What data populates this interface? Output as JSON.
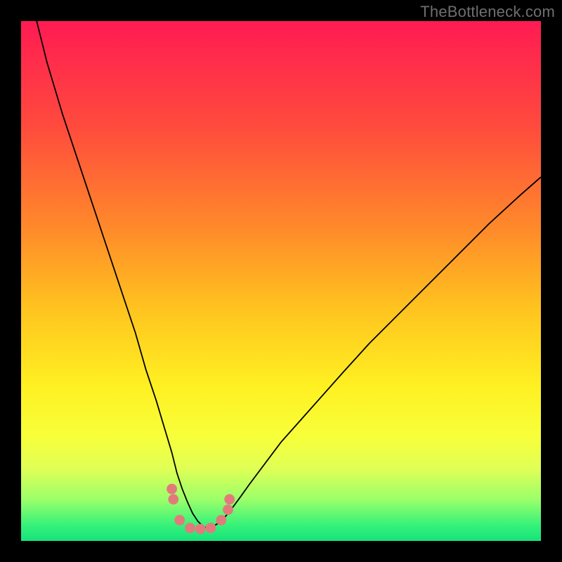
{
  "attribution": "TheBottleneck.com",
  "colors": {
    "frame": "#000000",
    "gradient_stops": [
      {
        "offset": 0.0,
        "color": "#ff1b53"
      },
      {
        "offset": 0.2,
        "color": "#ff4a3d"
      },
      {
        "offset": 0.4,
        "color": "#ff8a2a"
      },
      {
        "offset": 0.55,
        "color": "#ffc21f"
      },
      {
        "offset": 0.7,
        "color": "#fff022"
      },
      {
        "offset": 0.8,
        "color": "#f7ff3a"
      },
      {
        "offset": 0.86,
        "color": "#e0ff55"
      },
      {
        "offset": 0.92,
        "color": "#9cff6a"
      },
      {
        "offset": 0.97,
        "color": "#35f27a"
      },
      {
        "offset": 1.0,
        "color": "#16e37a"
      }
    ],
    "curve": "#000000",
    "markers_fill": "#e27a7d",
    "markers_stroke": "#d86a6d"
  },
  "chart_data": {
    "type": "line",
    "title": "",
    "xlabel": "",
    "ylabel": "",
    "xlim": [
      0,
      100
    ],
    "ylim": [
      0,
      100
    ],
    "series": [
      {
        "name": "bottleneck-curve",
        "x": [
          3,
          5,
          8,
          11,
          14,
          17,
          20,
          22,
          24,
          26,
          27.5,
          29,
          30,
          31,
          32,
          33,
          34,
          35,
          36,
          37,
          38.5,
          40,
          42,
          44,
          47,
          50,
          54,
          58,
          62,
          67,
          72,
          78,
          84,
          90,
          96,
          100
        ],
        "values": [
          100,
          92,
          82,
          73,
          64,
          55,
          46,
          40,
          33,
          27,
          22,
          17,
          13,
          10,
          7.5,
          5.3,
          3.8,
          2.8,
          2.4,
          2.8,
          3.8,
          5.5,
          8.2,
          11,
          15,
          19,
          23.5,
          28,
          32.5,
          38,
          43,
          49,
          55,
          61,
          66.5,
          70
        ]
      }
    ],
    "markers": [
      {
        "x": 29.0,
        "y": 10.0
      },
      {
        "x": 29.3,
        "y": 8.0
      },
      {
        "x": 30.5,
        "y": 4.0
      },
      {
        "x": 32.5,
        "y": 2.5
      },
      {
        "x": 34.5,
        "y": 2.3
      },
      {
        "x": 36.5,
        "y": 2.5
      },
      {
        "x": 38.5,
        "y": 4.0
      },
      {
        "x": 39.8,
        "y": 6.0
      },
      {
        "x": 40.1,
        "y": 8.0
      }
    ],
    "marker_radius_pct": 1.0
  }
}
